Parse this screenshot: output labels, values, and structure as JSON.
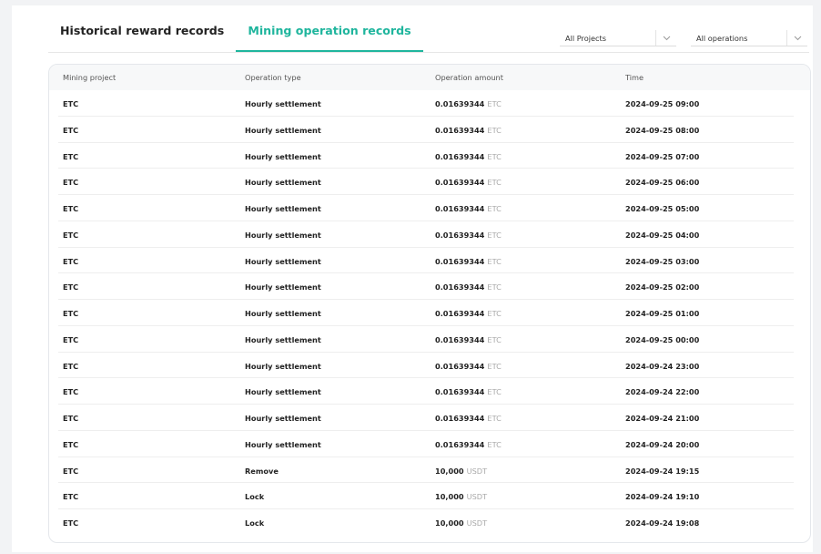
{
  "tabs": [
    {
      "label": "Historical reward records",
      "active": false
    },
    {
      "label": "Mining operation records",
      "active": true
    }
  ],
  "filters": {
    "project": {
      "value": "All Projects",
      "icon": "chevron-down-icon"
    },
    "operation": {
      "value": "All operations",
      "icon": "chevron-down-icon"
    }
  },
  "colors": {
    "accent": "#1fb59d",
    "text": "#222222",
    "muted": "#a8a8a8"
  },
  "table": {
    "headers": [
      "Mining project",
      "Operation type",
      "Operation amount",
      "Time"
    ],
    "rows": [
      {
        "project": "ETC",
        "type": "Hourly settlement",
        "amount": "0.01639344",
        "unit": "ETC",
        "time": "2024-09-25 09:00"
      },
      {
        "project": "ETC",
        "type": "Hourly settlement",
        "amount": "0.01639344",
        "unit": "ETC",
        "time": "2024-09-25 08:00"
      },
      {
        "project": "ETC",
        "type": "Hourly settlement",
        "amount": "0.01639344",
        "unit": "ETC",
        "time": "2024-09-25 07:00"
      },
      {
        "project": "ETC",
        "type": "Hourly settlement",
        "amount": "0.01639344",
        "unit": "ETC",
        "time": "2024-09-25 06:00"
      },
      {
        "project": "ETC",
        "type": "Hourly settlement",
        "amount": "0.01639344",
        "unit": "ETC",
        "time": "2024-09-25 05:00"
      },
      {
        "project": "ETC",
        "type": "Hourly settlement",
        "amount": "0.01639344",
        "unit": "ETC",
        "time": "2024-09-25 04:00"
      },
      {
        "project": "ETC",
        "type": "Hourly settlement",
        "amount": "0.01639344",
        "unit": "ETC",
        "time": "2024-09-25 03:00"
      },
      {
        "project": "ETC",
        "type": "Hourly settlement",
        "amount": "0.01639344",
        "unit": "ETC",
        "time": "2024-09-25 02:00"
      },
      {
        "project": "ETC",
        "type": "Hourly settlement",
        "amount": "0.01639344",
        "unit": "ETC",
        "time": "2024-09-25 01:00"
      },
      {
        "project": "ETC",
        "type": "Hourly settlement",
        "amount": "0.01639344",
        "unit": "ETC",
        "time": "2024-09-25 00:00"
      },
      {
        "project": "ETC",
        "type": "Hourly settlement",
        "amount": "0.01639344",
        "unit": "ETC",
        "time": "2024-09-24 23:00"
      },
      {
        "project": "ETC",
        "type": "Hourly settlement",
        "amount": "0.01639344",
        "unit": "ETC",
        "time": "2024-09-24 22:00"
      },
      {
        "project": "ETC",
        "type": "Hourly settlement",
        "amount": "0.01639344",
        "unit": "ETC",
        "time": "2024-09-24 21:00"
      },
      {
        "project": "ETC",
        "type": "Hourly settlement",
        "amount": "0.01639344",
        "unit": "ETC",
        "time": "2024-09-24 20:00"
      },
      {
        "project": "ETC",
        "type": "Remove",
        "amount": "10,000",
        "unit": "USDT",
        "time": "2024-09-24 19:15"
      },
      {
        "project": "ETC",
        "type": "Lock",
        "amount": "10,000",
        "unit": "USDT",
        "time": "2024-09-24 19:10"
      },
      {
        "project": "ETC",
        "type": "Lock",
        "amount": "10,000",
        "unit": "USDT",
        "time": "2024-09-24 19:08"
      }
    ]
  }
}
